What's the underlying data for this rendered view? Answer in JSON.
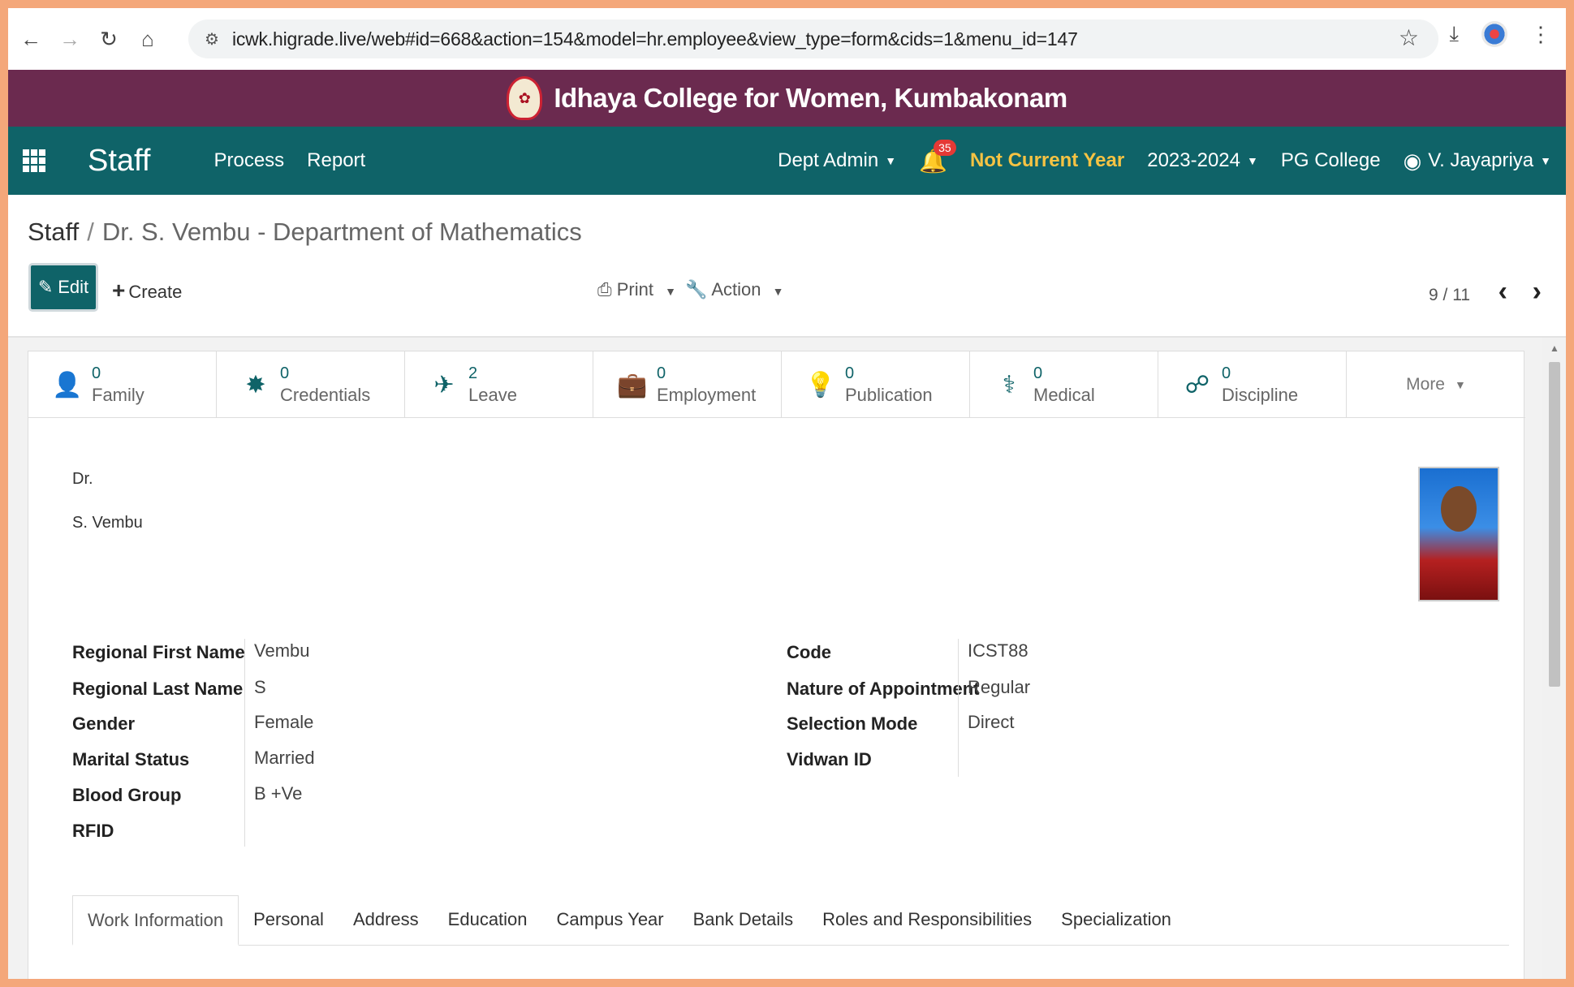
{
  "browser": {
    "url": "icwk.higrade.live/web#id=668&action=154&model=hr.employee&view_type=form&cids=1&menu_id=147",
    "icons": [
      "back-arrow-icon",
      "forward-arrow-icon",
      "reload-icon",
      "home-icon",
      "site-settings-icon",
      "star-icon",
      "download-icon",
      "profile-icon",
      "kebab-menu-icon"
    ]
  },
  "banner": {
    "title": "Idhaya College for Women, Kumbakonam"
  },
  "appbar": {
    "app_name": "Staff",
    "menu": [
      "Process",
      "Report"
    ],
    "dept": "Dept Admin",
    "notifications": "35",
    "year_status": "Not Current Year",
    "year": "2023-2024",
    "college": "PG College",
    "user": "V. Jayapriya",
    "colors": {
      "bar": "#0f6368",
      "banner": "#6b2a4f",
      "year_status": "#f6c343"
    }
  },
  "breadcrumb": {
    "root": "Staff",
    "current": "Dr. S. Vembu - Department of Mathematics"
  },
  "toolbar": {
    "edit": "Edit",
    "create": "Create",
    "print": "Print",
    "action": "Action",
    "pager": "9 / 11"
  },
  "smart_buttons": [
    {
      "count": "0",
      "label": "Family",
      "icon": "person-icon"
    },
    {
      "count": "0",
      "label": "Credentials",
      "icon": "certificate-icon"
    },
    {
      "count": "2",
      "label": "Leave",
      "icon": "plane-icon"
    },
    {
      "count": "0",
      "label": "Employment",
      "icon": "briefcase-icon"
    },
    {
      "count": "0",
      "label": "Publication",
      "icon": "lightbulb-icon"
    },
    {
      "count": "0",
      "label": "Medical",
      "icon": "stethoscope-icon"
    },
    {
      "count": "0",
      "label": "Discipline",
      "icon": "broken-link-icon"
    }
  ],
  "more": "More",
  "employee": {
    "title": "Dr.",
    "name": "S. Vembu"
  },
  "left_fields": [
    {
      "label": "Regional First Name",
      "value": "Vembu"
    },
    {
      "label": "Regional Last Name",
      "value": "S"
    },
    {
      "label": "Gender",
      "value": "Female"
    },
    {
      "label": "Marital Status",
      "value": "Married"
    },
    {
      "label": "Blood Group",
      "value": "B +Ve"
    },
    {
      "label": "RFID",
      "value": ""
    }
  ],
  "right_fields": [
    {
      "label": "Code",
      "value": "ICST88"
    },
    {
      "label": "Nature of Appointment",
      "value": "Regular"
    },
    {
      "label": "Selection Mode",
      "value": "Direct"
    },
    {
      "label": "Vidwan ID",
      "value": ""
    }
  ],
  "tabs": [
    "Work Information",
    "Personal",
    "Address",
    "Education",
    "Campus Year",
    "Bank Details",
    "Roles and Responsibilities",
    "Specialization"
  ]
}
